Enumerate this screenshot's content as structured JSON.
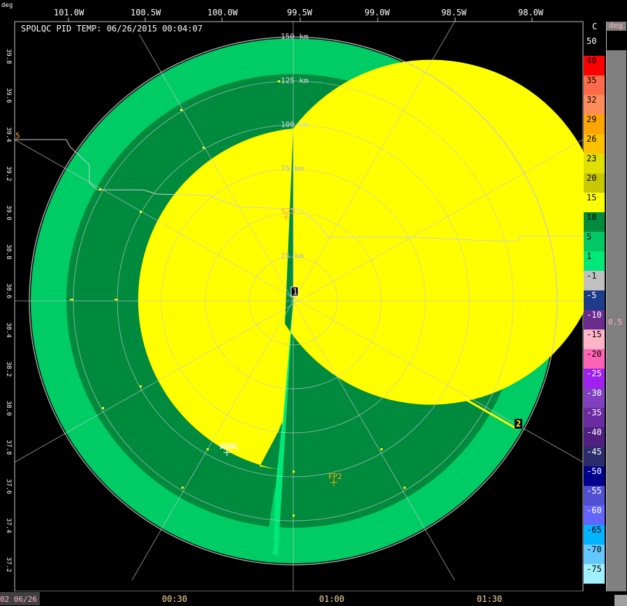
{
  "header": {
    "title": "SPOLQC PID TEMP: 06/26/2015 00:04:07",
    "units_left": "deg",
    "legend_unit": "C",
    "side_unit": "deg",
    "side_value": "0.5"
  },
  "lon_ticks": [
    "101.0W",
    "100.5W",
    "100.0W",
    "99.5W",
    "99.0W",
    "98.5W",
    "98.0W"
  ],
  "lat_ticks": [
    "39.8",
    "39.6",
    "39.4",
    "39.2",
    "39.0",
    "38.8",
    "38.6",
    "38.4",
    "38.2",
    "38.0",
    "37.8",
    "37.6",
    "37.4",
    "37.2"
  ],
  "range_labels": [
    "150 km",
    "125 km",
    "100 km",
    "75 km",
    "25 km"
  ],
  "sites": {
    "center": "1",
    "kddc": "KDDC",
    "fp2": "FP2",
    "s23": "S23",
    "marker2": "2",
    "edge5": "5"
  },
  "time_axis": {
    "left_label": "02 06/26",
    "ticks": [
      "00:30",
      "01:00",
      "01:30"
    ]
  },
  "legend": [
    {
      "label": "50",
      "color": "#000000",
      "text": "white"
    },
    {
      "label": "40",
      "color": "#ff0000",
      "text": "black"
    },
    {
      "label": "35",
      "color": "#ff6a4a",
      "text": "black"
    },
    {
      "label": "32",
      "color": "#ff8c5a",
      "text": "black"
    },
    {
      "label": "29",
      "color": "#ffa500",
      "text": "black"
    },
    {
      "label": "26",
      "color": "#ffc000",
      "text": "black"
    },
    {
      "label": "23",
      "color": "#e0e000",
      "text": "black"
    },
    {
      "label": "20",
      "color": "#c8c800",
      "text": "black"
    },
    {
      "label": "15",
      "color": "#ffff00",
      "text": "black"
    },
    {
      "label": "10",
      "color": "#008c3c",
      "text": "black"
    },
    {
      "label": "5",
      "color": "#00c864",
      "text": "black"
    },
    {
      "label": "1",
      "color": "#00e878",
      "text": "black"
    },
    {
      "label": "-1",
      "color": "#c0c0c0",
      "text": "black"
    },
    {
      "label": "-5",
      "color": "#1e3c8c",
      "text": "white"
    },
    {
      "label": "-10",
      "color": "#6a2c8c",
      "text": "white"
    },
    {
      "label": "-15",
      "color": "#ffb4c8",
      "text": "black"
    },
    {
      "label": "-20",
      "color": "#ff64b4",
      "text": "black"
    },
    {
      "label": "-25",
      "color": "#a020f0",
      "text": "white"
    },
    {
      "label": "-30",
      "color": "#8040c0",
      "text": "white"
    },
    {
      "label": "-35",
      "color": "#6a2aa0",
      "text": "white"
    },
    {
      "label": "-40",
      "color": "#502080",
      "text": "white"
    },
    {
      "label": "-45",
      "color": "#2c2c6a",
      "text": "white"
    },
    {
      "label": "-50",
      "color": "#00008c",
      "text": "white"
    },
    {
      "label": "-55",
      "color": "#5050d0",
      "text": "white"
    },
    {
      "label": "-60",
      "color": "#6464ff",
      "text": "white"
    },
    {
      "label": "-65",
      "color": "#00b4ff",
      "text": "black"
    },
    {
      "label": "-70",
      "color": "#64c8ff",
      "text": "black"
    },
    {
      "label": "-75",
      "color": "#a0f0ff",
      "text": "black"
    }
  ],
  "colors": {
    "outer_ring": "#00cc66",
    "mid_ring": "#008a3e",
    "inner_disk": "#ffff00",
    "grid": "#c8c8c8"
  }
}
